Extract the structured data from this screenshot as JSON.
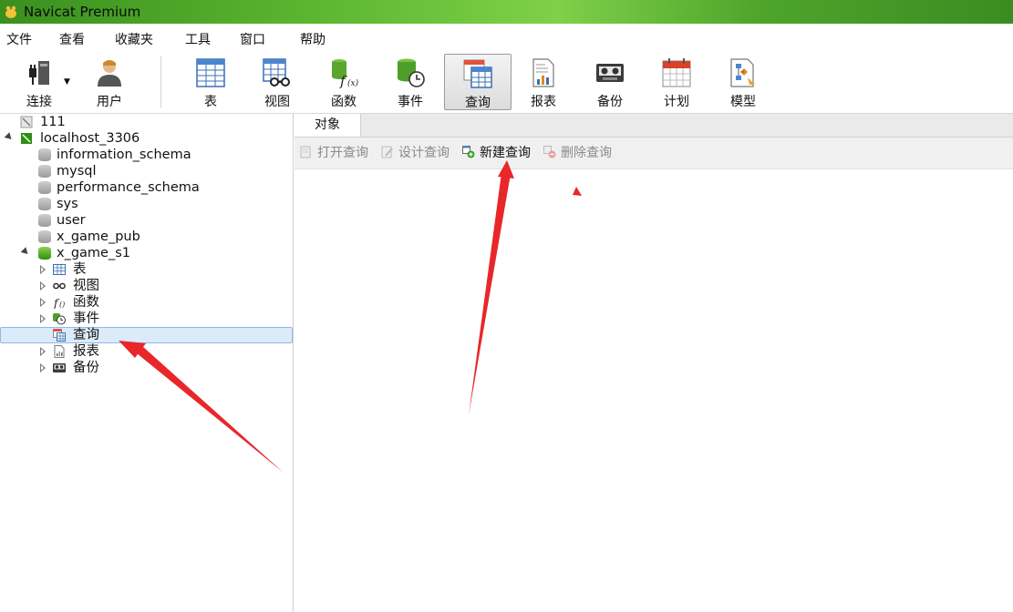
{
  "window": {
    "title": "Navicat Premium"
  },
  "menu": [
    "文件",
    "查看",
    "收藏夹",
    "工具",
    "窗口",
    "帮助"
  ],
  "toolbar": {
    "buttons": [
      {
        "label": "连接",
        "icon": "connection-icon"
      },
      {
        "label": "用户",
        "icon": "user-icon"
      },
      {
        "label": "表",
        "icon": "table-icon"
      },
      {
        "label": "视图",
        "icon": "view-icon"
      },
      {
        "label": "函数",
        "icon": "function-icon"
      },
      {
        "label": "事件",
        "icon": "event-icon"
      },
      {
        "label": "查询",
        "icon": "query-icon",
        "active": true
      },
      {
        "label": "报表",
        "icon": "report-icon"
      },
      {
        "label": "备份",
        "icon": "backup-icon"
      },
      {
        "label": "计划",
        "icon": "schedule-icon"
      },
      {
        "label": "模型",
        "icon": "model-icon"
      }
    ]
  },
  "tree": {
    "connections": [
      {
        "name": "111"
      },
      {
        "name": "localhost_3306",
        "databases": [
          "information_schema",
          "mysql",
          "performance_schema",
          "sys",
          "user",
          "x_game_pub"
        ],
        "open_db": {
          "name": "x_game_s1",
          "children": [
            "表",
            "视图",
            "函数",
            "事件",
            "查询",
            "报表",
            "备份"
          ],
          "selected": "查询"
        }
      }
    ]
  },
  "right_panel": {
    "tab": "对象",
    "actions": [
      {
        "label": "打开查询",
        "enabled": false
      },
      {
        "label": "设计查询",
        "enabled": false
      },
      {
        "label": "新建查询",
        "enabled": true
      },
      {
        "label": "删除查询",
        "enabled": false
      }
    ]
  },
  "colors": {
    "titlebar": "#4ea52a",
    "selection": "#dcebfa",
    "arrow": "#e8272b"
  }
}
